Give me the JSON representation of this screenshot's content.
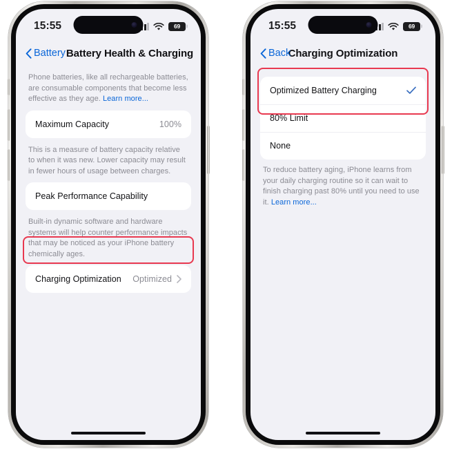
{
  "phones": [
    {
      "id": "battery-health",
      "status_bar": {
        "time": "15:55",
        "signal_icon": "cellular-signal-icon",
        "wifi_icon": "wifi-icon",
        "battery_icon": "battery-icon",
        "battery_percent": "69"
      },
      "nav": {
        "back_label": "Battery",
        "back_icon": "chevron-left-icon",
        "title": "Battery Health & Charging"
      },
      "intro_text": "Phone batteries, like all rechargeable batteries, are consumable components that become less effective as they age. ",
      "intro_link": "Learn more...",
      "rows": {
        "maximum_capacity_label": "Maximum Capacity",
        "maximum_capacity_value": "100%",
        "capacity_footnote": "This is a measure of battery capacity relative to when it was new. Lower capacity may result in fewer hours of usage between charges.",
        "peak_performance_label": "Peak Performance Capability",
        "peak_footnote": "Built-in dynamic software and hardware systems will help counter performance impacts that may be noticed as your iPhone battery chemically ages.",
        "charging_optimization_label": "Charging Optimization",
        "charging_optimization_value": "Optimized",
        "charging_optimization_chevron": "chevron-right-icon"
      }
    },
    {
      "id": "charging-optimization",
      "status_bar": {
        "time": "15:55",
        "signal_icon": "cellular-signal-icon",
        "wifi_icon": "wifi-icon",
        "battery_icon": "battery-icon",
        "battery_percent": "69"
      },
      "nav": {
        "back_label": "Back",
        "back_icon": "chevron-left-icon",
        "title": "Charging Optimization"
      },
      "options": [
        {
          "label": "Optimized Battery Charging",
          "selected": true,
          "check_icon": "checkmark-icon"
        },
        {
          "label": "80% Limit",
          "selected": false,
          "check_icon": ""
        },
        {
          "label": "None",
          "selected": false,
          "check_icon": ""
        }
      ],
      "footnote_text": "To reduce battery aging, iPhone learns from your daily charging routine so it can wait to finish charging past 80% until you need to use it. ",
      "footnote_link": "Learn more..."
    }
  ],
  "colors": {
    "accent_blue": "#0a66d8",
    "highlight_red": "#e8384f",
    "screen_background": "#f1f1f6",
    "card_background": "#ffffff",
    "secondary_text": "#8b8b93"
  }
}
